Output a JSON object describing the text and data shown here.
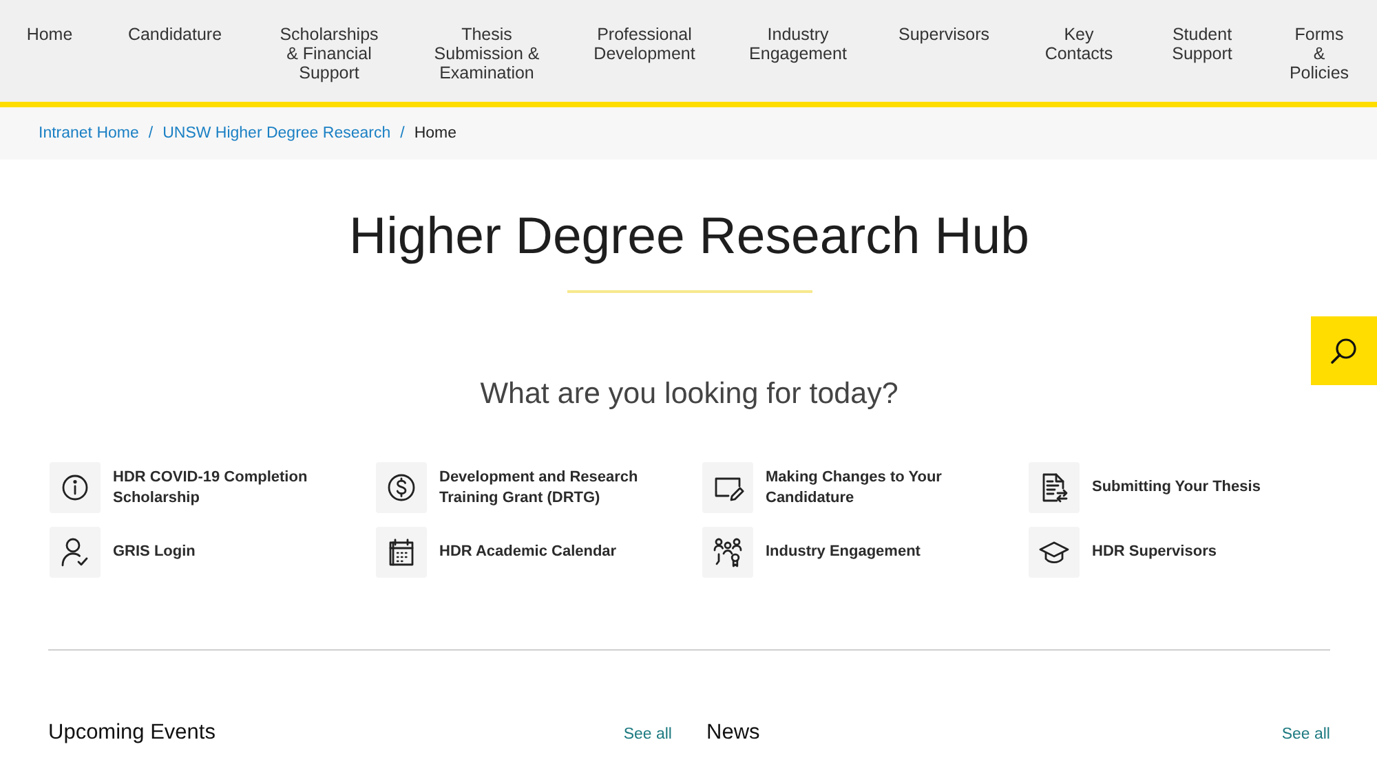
{
  "nav": {
    "items": [
      {
        "label": "Home"
      },
      {
        "label": "Candidature"
      },
      {
        "label": "Scholarships & Financial Support"
      },
      {
        "label": "Thesis Submission & Examination"
      },
      {
        "label": "Professional Development"
      },
      {
        "label": "Industry Engagement"
      },
      {
        "label": "Supervisors"
      },
      {
        "label": "Key Contacts"
      },
      {
        "label": "Student Support"
      },
      {
        "label": "Forms & Policies"
      }
    ]
  },
  "breadcrumb": [
    {
      "label": "Intranet Home",
      "current": false,
      "separator": "/"
    },
    {
      "label": "UNSW Higher Degree Research",
      "current": false,
      "separator": "/"
    },
    {
      "label": "Home",
      "current": true
    }
  ],
  "hero": {
    "title": "Higher Degree Research Hub",
    "subtitle": "What are you looking for today?"
  },
  "quick_links": [
    {
      "label": "HDR COVID-19 Completion Scholarship"
    },
    {
      "label": "Development and Research Training Grant (DRTG)"
    },
    {
      "label": "Making Changes to Your Candidature"
    },
    {
      "label": "Submitting Your Thesis"
    },
    {
      "label": "GRIS Login"
    },
    {
      "label": "HDR Academic Calendar"
    },
    {
      "label": "Industry Engagement"
    },
    {
      "label": "HDR Supervisors"
    }
  ],
  "sections": [
    {
      "title": "Upcoming Events",
      "link": "See all"
    },
    {
      "title": "News",
      "link": "See all"
    }
  ]
}
